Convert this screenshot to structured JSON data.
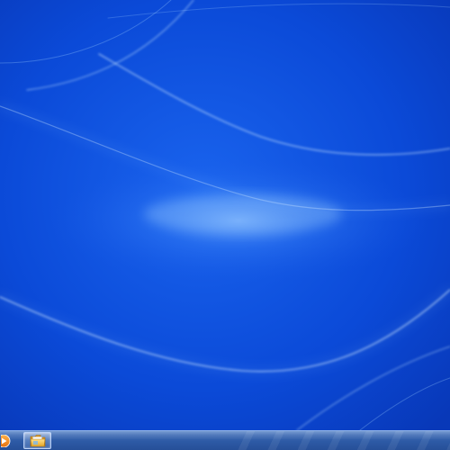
{
  "desktop": {
    "wallpaper": "blue-light-streaks",
    "colors": {
      "base": "#0b4ad8",
      "deep": "#0838b8",
      "glow": "#4f95ff",
      "streak": "#bfe0ff"
    }
  },
  "taskbar": {
    "colors": {
      "top": "#5a86c8",
      "bottom": "#264f98",
      "border": "#8db0e6"
    },
    "pinned_items": [
      {
        "name": "windows-media-player",
        "icon": "media-player-icon",
        "color": "#f08a1c"
      },
      {
        "name": "windows-explorer",
        "icon": "folder-icon",
        "color": "#f3c24a"
      }
    ]
  }
}
